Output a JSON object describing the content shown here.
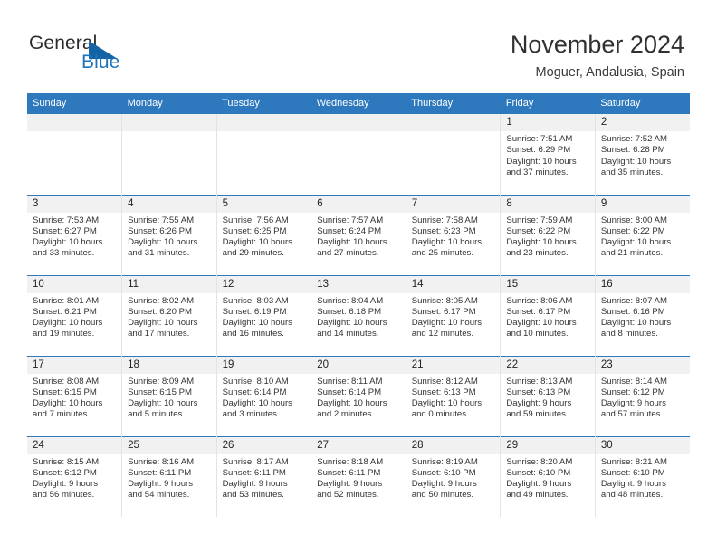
{
  "brand": {
    "name_part1": "General",
    "name_part2": "Blue",
    "accent_color": "#1c75bc",
    "triangle_color": "#1464a5"
  },
  "header": {
    "month_title": "November 2024",
    "location": "Moguer, Andalusia, Spain"
  },
  "theme": {
    "header_blue": "#2e78bd",
    "daynum_band": "#f1f1f1",
    "cell_bg": "#ffffff",
    "text": "#333333"
  },
  "calendar": {
    "weekday_headers": [
      "Sunday",
      "Monday",
      "Tuesday",
      "Wednesday",
      "Thursday",
      "Friday",
      "Saturday"
    ],
    "weeks": [
      [
        {
          "day": "",
          "empty": true
        },
        {
          "day": "",
          "empty": true
        },
        {
          "day": "",
          "empty": true
        },
        {
          "day": "",
          "empty": true
        },
        {
          "day": "",
          "empty": true
        },
        {
          "day": "1",
          "sunrise": "Sunrise: 7:51 AM",
          "sunset": "Sunset: 6:29 PM",
          "daylight_line1": "Daylight: 10 hours",
          "daylight_line2": "and 37 minutes."
        },
        {
          "day": "2",
          "sunrise": "Sunrise: 7:52 AM",
          "sunset": "Sunset: 6:28 PM",
          "daylight_line1": "Daylight: 10 hours",
          "daylight_line2": "and 35 minutes."
        }
      ],
      [
        {
          "day": "3",
          "sunrise": "Sunrise: 7:53 AM",
          "sunset": "Sunset: 6:27 PM",
          "daylight_line1": "Daylight: 10 hours",
          "daylight_line2": "and 33 minutes."
        },
        {
          "day": "4",
          "sunrise": "Sunrise: 7:55 AM",
          "sunset": "Sunset: 6:26 PM",
          "daylight_line1": "Daylight: 10 hours",
          "daylight_line2": "and 31 minutes."
        },
        {
          "day": "5",
          "sunrise": "Sunrise: 7:56 AM",
          "sunset": "Sunset: 6:25 PM",
          "daylight_line1": "Daylight: 10 hours",
          "daylight_line2": "and 29 minutes."
        },
        {
          "day": "6",
          "sunrise": "Sunrise: 7:57 AM",
          "sunset": "Sunset: 6:24 PM",
          "daylight_line1": "Daylight: 10 hours",
          "daylight_line2": "and 27 minutes."
        },
        {
          "day": "7",
          "sunrise": "Sunrise: 7:58 AM",
          "sunset": "Sunset: 6:23 PM",
          "daylight_line1": "Daylight: 10 hours",
          "daylight_line2": "and 25 minutes."
        },
        {
          "day": "8",
          "sunrise": "Sunrise: 7:59 AM",
          "sunset": "Sunset: 6:22 PM",
          "daylight_line1": "Daylight: 10 hours",
          "daylight_line2": "and 23 minutes."
        },
        {
          "day": "9",
          "sunrise": "Sunrise: 8:00 AM",
          "sunset": "Sunset: 6:22 PM",
          "daylight_line1": "Daylight: 10 hours",
          "daylight_line2": "and 21 minutes."
        }
      ],
      [
        {
          "day": "10",
          "sunrise": "Sunrise: 8:01 AM",
          "sunset": "Sunset: 6:21 PM",
          "daylight_line1": "Daylight: 10 hours",
          "daylight_line2": "and 19 minutes."
        },
        {
          "day": "11",
          "sunrise": "Sunrise: 8:02 AM",
          "sunset": "Sunset: 6:20 PM",
          "daylight_line1": "Daylight: 10 hours",
          "daylight_line2": "and 17 minutes."
        },
        {
          "day": "12",
          "sunrise": "Sunrise: 8:03 AM",
          "sunset": "Sunset: 6:19 PM",
          "daylight_line1": "Daylight: 10 hours",
          "daylight_line2": "and 16 minutes."
        },
        {
          "day": "13",
          "sunrise": "Sunrise: 8:04 AM",
          "sunset": "Sunset: 6:18 PM",
          "daylight_line1": "Daylight: 10 hours",
          "daylight_line2": "and 14 minutes."
        },
        {
          "day": "14",
          "sunrise": "Sunrise: 8:05 AM",
          "sunset": "Sunset: 6:17 PM",
          "daylight_line1": "Daylight: 10 hours",
          "daylight_line2": "and 12 minutes."
        },
        {
          "day": "15",
          "sunrise": "Sunrise: 8:06 AM",
          "sunset": "Sunset: 6:17 PM",
          "daylight_line1": "Daylight: 10 hours",
          "daylight_line2": "and 10 minutes."
        },
        {
          "day": "16",
          "sunrise": "Sunrise: 8:07 AM",
          "sunset": "Sunset: 6:16 PM",
          "daylight_line1": "Daylight: 10 hours",
          "daylight_line2": "and 8 minutes."
        }
      ],
      [
        {
          "day": "17",
          "sunrise": "Sunrise: 8:08 AM",
          "sunset": "Sunset: 6:15 PM",
          "daylight_line1": "Daylight: 10 hours",
          "daylight_line2": "and 7 minutes."
        },
        {
          "day": "18",
          "sunrise": "Sunrise: 8:09 AM",
          "sunset": "Sunset: 6:15 PM",
          "daylight_line1": "Daylight: 10 hours",
          "daylight_line2": "and 5 minutes."
        },
        {
          "day": "19",
          "sunrise": "Sunrise: 8:10 AM",
          "sunset": "Sunset: 6:14 PM",
          "daylight_line1": "Daylight: 10 hours",
          "daylight_line2": "and 3 minutes."
        },
        {
          "day": "20",
          "sunrise": "Sunrise: 8:11 AM",
          "sunset": "Sunset: 6:14 PM",
          "daylight_line1": "Daylight: 10 hours",
          "daylight_line2": "and 2 minutes."
        },
        {
          "day": "21",
          "sunrise": "Sunrise: 8:12 AM",
          "sunset": "Sunset: 6:13 PM",
          "daylight_line1": "Daylight: 10 hours",
          "daylight_line2": "and 0 minutes."
        },
        {
          "day": "22",
          "sunrise": "Sunrise: 8:13 AM",
          "sunset": "Sunset: 6:13 PM",
          "daylight_line1": "Daylight: 9 hours",
          "daylight_line2": "and 59 minutes."
        },
        {
          "day": "23",
          "sunrise": "Sunrise: 8:14 AM",
          "sunset": "Sunset: 6:12 PM",
          "daylight_line1": "Daylight: 9 hours",
          "daylight_line2": "and 57 minutes."
        }
      ],
      [
        {
          "day": "24",
          "sunrise": "Sunrise: 8:15 AM",
          "sunset": "Sunset: 6:12 PM",
          "daylight_line1": "Daylight: 9 hours",
          "daylight_line2": "and 56 minutes."
        },
        {
          "day": "25",
          "sunrise": "Sunrise: 8:16 AM",
          "sunset": "Sunset: 6:11 PM",
          "daylight_line1": "Daylight: 9 hours",
          "daylight_line2": "and 54 minutes."
        },
        {
          "day": "26",
          "sunrise": "Sunrise: 8:17 AM",
          "sunset": "Sunset: 6:11 PM",
          "daylight_line1": "Daylight: 9 hours",
          "daylight_line2": "and 53 minutes."
        },
        {
          "day": "27",
          "sunrise": "Sunrise: 8:18 AM",
          "sunset": "Sunset: 6:11 PM",
          "daylight_line1": "Daylight: 9 hours",
          "daylight_line2": "and 52 minutes."
        },
        {
          "day": "28",
          "sunrise": "Sunrise: 8:19 AM",
          "sunset": "Sunset: 6:10 PM",
          "daylight_line1": "Daylight: 9 hours",
          "daylight_line2": "and 50 minutes."
        },
        {
          "day": "29",
          "sunrise": "Sunrise: 8:20 AM",
          "sunset": "Sunset: 6:10 PM",
          "daylight_line1": "Daylight: 9 hours",
          "daylight_line2": "and 49 minutes."
        },
        {
          "day": "30",
          "sunrise": "Sunrise: 8:21 AM",
          "sunset": "Sunset: 6:10 PM",
          "daylight_line1": "Daylight: 9 hours",
          "daylight_line2": "and 48 minutes."
        }
      ]
    ]
  }
}
